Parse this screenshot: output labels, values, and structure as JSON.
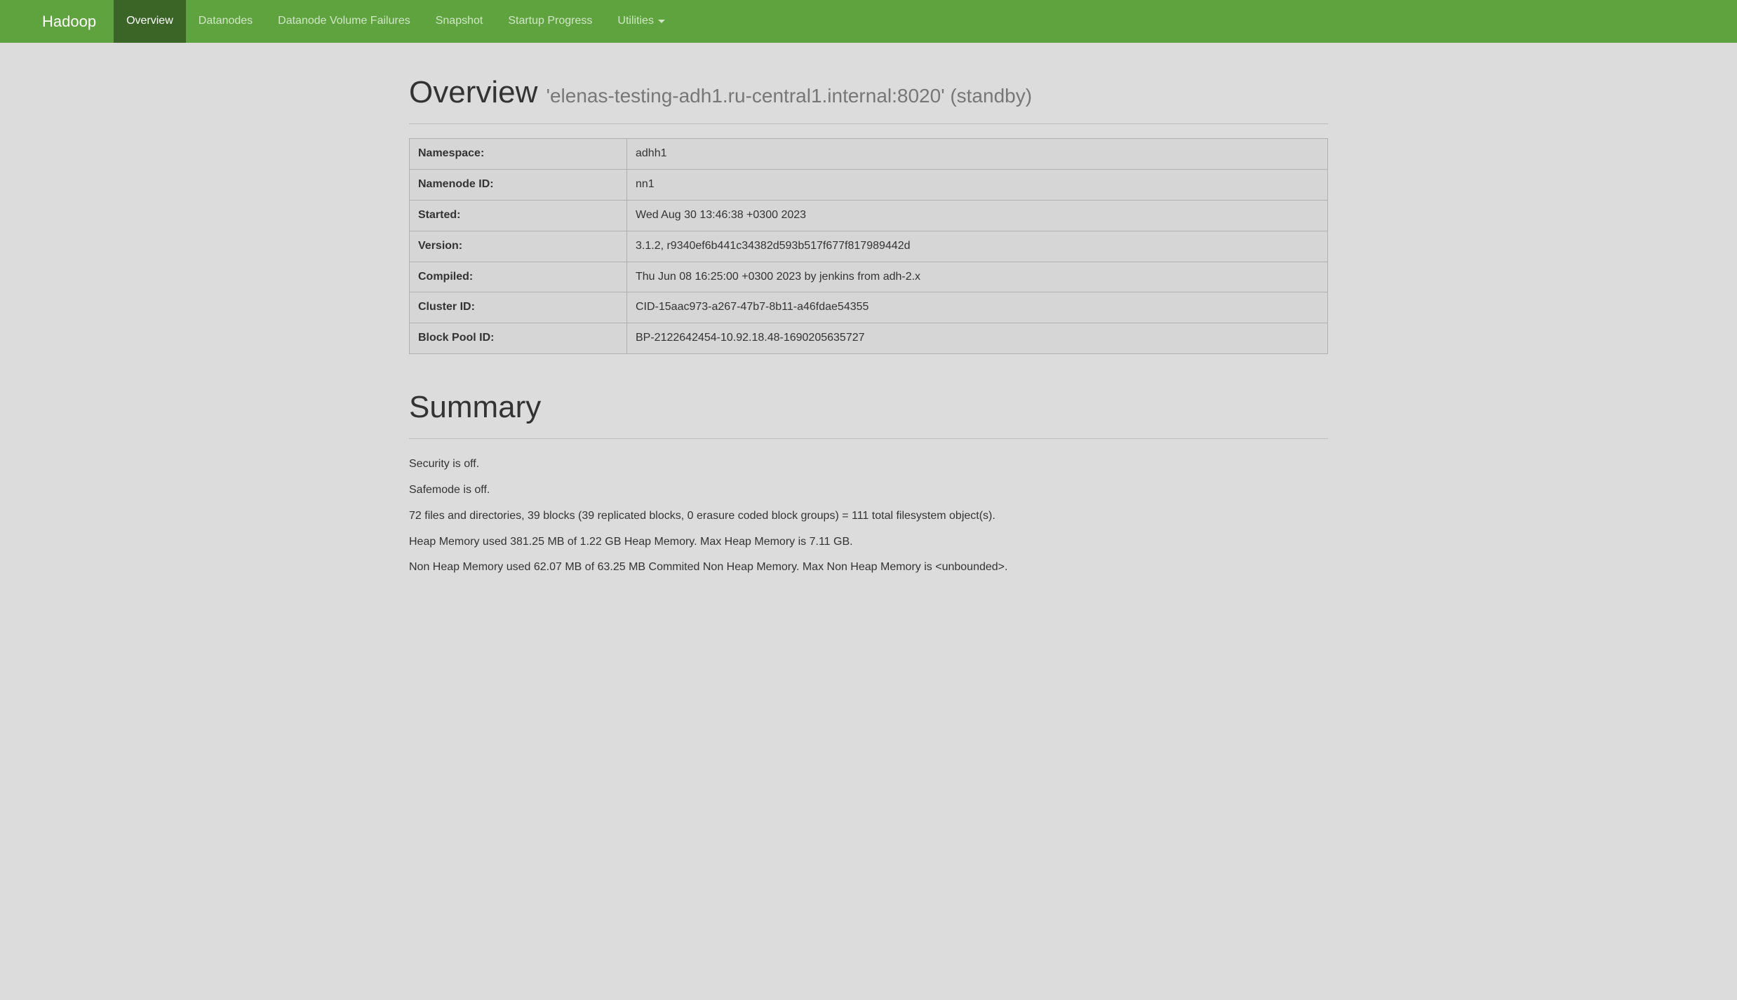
{
  "navbar": {
    "brand": "Hadoop",
    "items": [
      {
        "label": "Overview",
        "active": true
      },
      {
        "label": "Datanodes",
        "active": false
      },
      {
        "label": "Datanode Volume Failures",
        "active": false
      },
      {
        "label": "Snapshot",
        "active": false
      },
      {
        "label": "Startup Progress",
        "active": false
      },
      {
        "label": "Utilities",
        "active": false,
        "dropdown": true
      }
    ]
  },
  "overview": {
    "title": "Overview",
    "subtitle": "'elenas-testing-adh1.ru-central1.internal:8020' (standby)",
    "rows": [
      {
        "label": "Namespace:",
        "value": "adhh1"
      },
      {
        "label": "Namenode ID:",
        "value": "nn1"
      },
      {
        "label": "Started:",
        "value": "Wed Aug 30 13:46:38 +0300 2023"
      },
      {
        "label": "Version:",
        "value": "3.1.2, r9340ef6b441c34382d593b517f677f817989442d"
      },
      {
        "label": "Compiled:",
        "value": "Thu Jun 08 16:25:00 +0300 2023 by jenkins from adh-2.x"
      },
      {
        "label": "Cluster ID:",
        "value": "CID-15aac973-a267-47b7-8b11-a46fdae54355"
      },
      {
        "label": "Block Pool ID:",
        "value": "BP-2122642454-10.92.18.48-1690205635727"
      }
    ]
  },
  "summary": {
    "title": "Summary",
    "lines": [
      "Security is off.",
      "Safemode is off.",
      "72 files and directories, 39 blocks (39 replicated blocks, 0 erasure coded block groups) = 111 total filesystem object(s).",
      "Heap Memory used 381.25 MB of 1.22 GB Heap Memory. Max Heap Memory is 7.11 GB.",
      "Non Heap Memory used 62.07 MB of 63.25 MB Commited Non Heap Memory. Max Non Heap Memory is <unbounded>."
    ]
  }
}
